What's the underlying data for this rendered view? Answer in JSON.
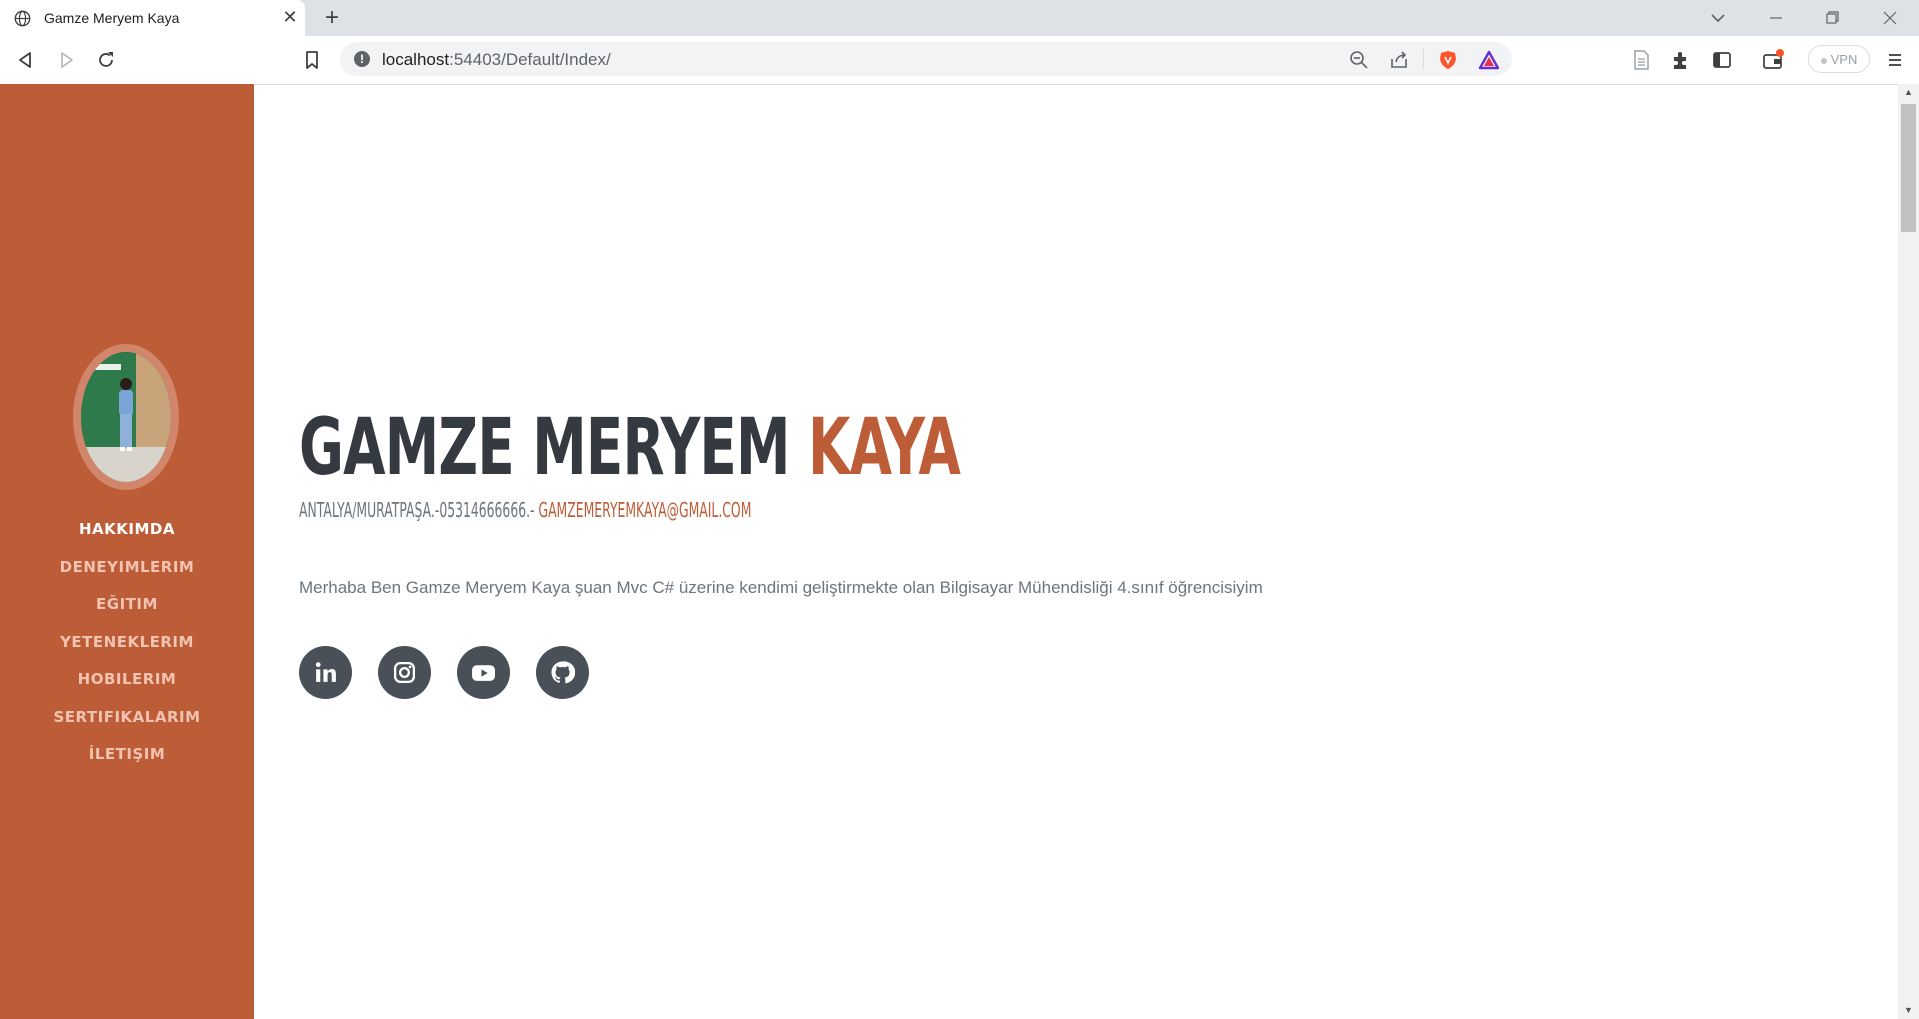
{
  "browser": {
    "tab_title": "Gamze Meryem Kaya",
    "url_host": "localhost",
    "url_rest": ":54403/Default/Index/",
    "vpn_label": "VPN"
  },
  "sidebar": {
    "avatar_icon": "profile-photo",
    "nav": [
      {
        "label": "HAKKIMDA",
        "active": true
      },
      {
        "label": "DENEYIMLERIM"
      },
      {
        "label": "EĞITIM"
      },
      {
        "label": "YETENEKLERIM"
      },
      {
        "label": "HOBILERIM"
      },
      {
        "label": "SERTIFIKALARIM"
      },
      {
        "label": "İLETIŞIM"
      }
    ]
  },
  "hero": {
    "first_name": "GAMZE MERYEM",
    "last_name": "KAYA",
    "address": "ANTALYA/MURATPAŞA.-05314666666.-",
    "email": "GAMZEMERYEMKAYA@GMAIL.COM",
    "lead": "Merhaba Ben Gamze Meryem Kaya şuan Mvc C# üzerine kendimi geliştirmekte olan Bilgisayar Mühendisliği 4.sınıf öğrencisiyim"
  },
  "socials": [
    "linkedin-icon",
    "instagram-icon",
    "youtube-icon",
    "github-icon"
  ],
  "colors": {
    "primary": "#bd5d38",
    "dark": "#343a40",
    "muted": "#6c757d",
    "icon_bg": "#495057"
  }
}
